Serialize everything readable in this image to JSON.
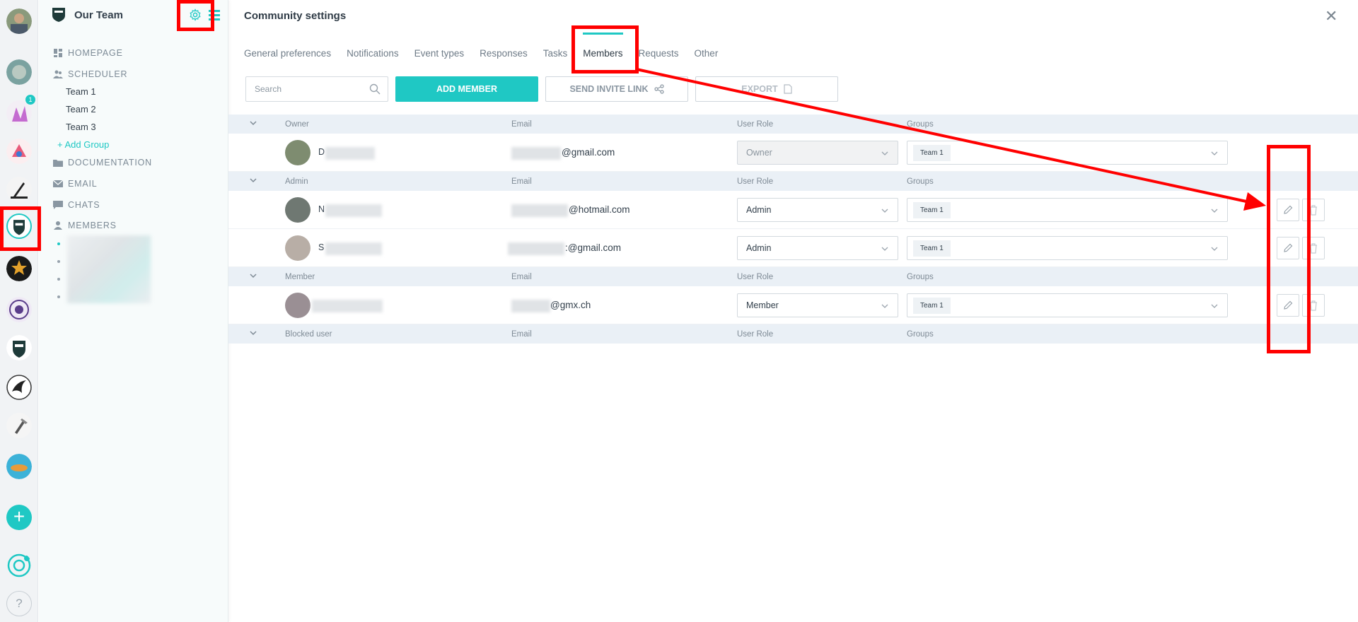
{
  "sidebar": {
    "team_name": "Our Team",
    "sections": {
      "homepage": "HOMEPAGE",
      "scheduler": "SCHEDULER",
      "documentation": "DOCUMENTATION",
      "email": "EMAIL",
      "chats": "CHATS",
      "members": "MEMBERS"
    },
    "teams": [
      "Team 1",
      "Team 2",
      "Team 3"
    ],
    "add_group": "+ Add Group"
  },
  "rail": {
    "badge": "1",
    "help": "?"
  },
  "main": {
    "title": "Community settings",
    "tabs": [
      "General preferences",
      "Notifications",
      "Event types",
      "Responses",
      "Tasks",
      "Members",
      "Requests",
      "Other"
    ],
    "active_tab": "Members",
    "search_placeholder": "Search",
    "add_member": "ADD MEMBER",
    "send_invite": "SEND INVITE LINK",
    "export": "EXPORT"
  },
  "columns": {
    "email": "Email",
    "role": "User Role",
    "groups": "Groups"
  },
  "groups": {
    "owner": {
      "label": "Owner",
      "members": [
        {
          "name": "D",
          "email": "@gmail.com",
          "role": "Owner",
          "group": "Team 1"
        }
      ]
    },
    "admin": {
      "label": "Admin",
      "members": [
        {
          "name": "N",
          "email": "@hotmail.com",
          "role": "Admin",
          "group": "Team 1"
        },
        {
          "name": "S",
          "email": ":@gmail.com",
          "role": "Admin",
          "group": "Team 1"
        }
      ]
    },
    "member": {
      "label": "Member",
      "members": [
        {
          "name": "",
          "email": "@gmx.ch",
          "role": "Member",
          "group": "Team 1"
        }
      ]
    },
    "blocked": {
      "label": "Blocked user"
    }
  },
  "colors": {
    "accent": "#1fc8c4",
    "annotation": "#ff0000",
    "group_row": "#eaf0f6"
  }
}
